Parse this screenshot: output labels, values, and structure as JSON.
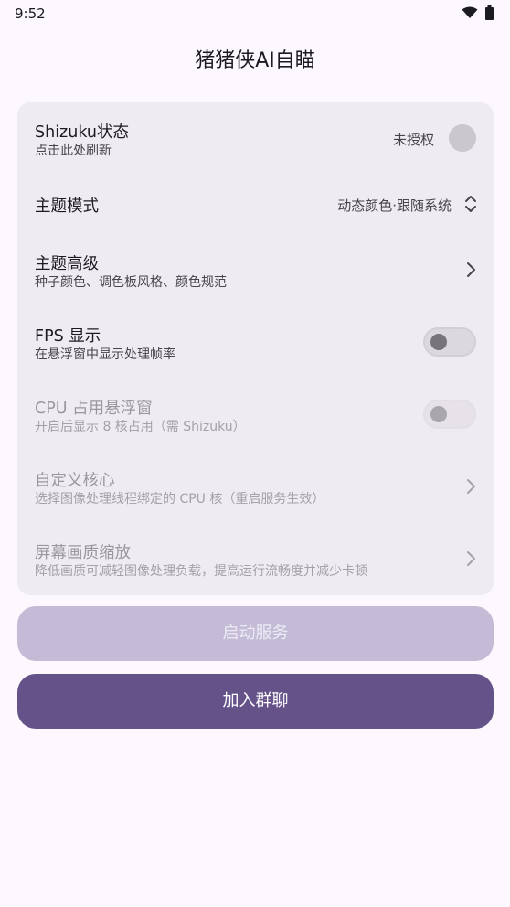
{
  "status_bar": {
    "time": "9:52",
    "icons": [
      "wifi-icon",
      "battery-icon"
    ]
  },
  "app": {
    "title": "猪猪侠AI自瞄"
  },
  "settings": {
    "shizuku": {
      "title": "Shizuku状态",
      "subtitle": "点击此处刷新",
      "status": "未授权"
    },
    "theme_mode": {
      "title": "主题模式",
      "value": "动态颜色·跟随系统"
    },
    "theme_advanced": {
      "title": "主题高级",
      "subtitle": "种子颜色、调色板风格、颜色规范"
    },
    "fps": {
      "title": "FPS 显示",
      "subtitle": "在悬浮窗中显示处理帧率",
      "enabled": false
    },
    "cpu_overlay": {
      "title": "CPU 占用悬浮窗",
      "subtitle": "开启后显示 8 核占用（需 Shizuku）",
      "enabled": false,
      "disabled": true
    },
    "custom_core": {
      "title": "自定义核心",
      "subtitle": "选择图像处理线程绑定的 CPU 核（重启服务生效）",
      "disabled": true
    },
    "screen_scale": {
      "title": "屏幕画质缩放",
      "subtitle": "降低画质可减轻图像处理负载，提高运行流畅度并减少卡顿",
      "disabled": true
    }
  },
  "buttons": {
    "start_service": "启动服务",
    "join_group": "加入群聊"
  },
  "colors": {
    "primary": "#645289",
    "primary_disabled": "#c4bbd6",
    "card": "#efebf2",
    "background": "#fcf8fd"
  }
}
